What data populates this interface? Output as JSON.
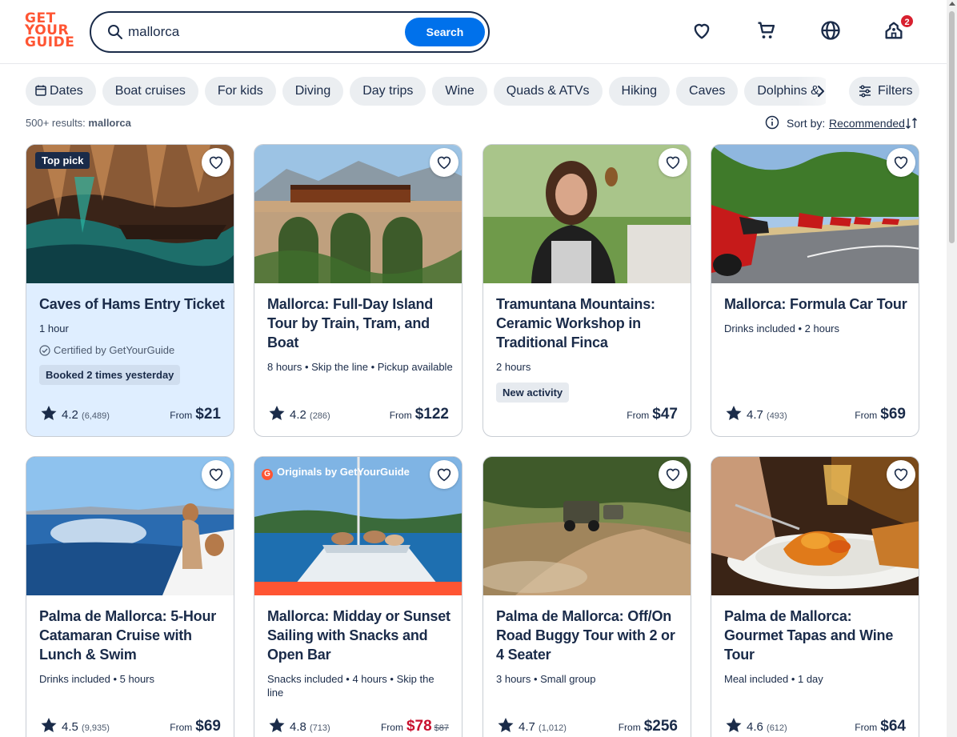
{
  "header": {
    "logo_lines": [
      "GET",
      "YOUR",
      "GUIDE"
    ],
    "search_value": "mallorca",
    "search_button": "Search",
    "cart_badge": "2"
  },
  "chips": [
    "Dates",
    "Boat cruises",
    "For kids",
    "Diving",
    "Day trips",
    "Wine",
    "Quads & ATVs",
    "Hiking",
    "Caves",
    "Dolphins &"
  ],
  "filters_label": "Filters",
  "results": {
    "count": "500+ results:",
    "query": "mallorca"
  },
  "sort": {
    "label": "Sort by:",
    "value": "Recommended"
  },
  "cards": [
    {
      "badge": "Top pick",
      "title": "Caves of Hams Entry Ticket",
      "meta": "1 hour",
      "certified": "Certified by GetYourGuide",
      "pill": "Booked 2 times yesterday",
      "rating": "4.2",
      "reviews": "(6,489)",
      "from": "From",
      "price": "$21"
    },
    {
      "title": "Mallorca: Full-Day Island Tour by Train, Tram, and Boat",
      "meta": "8 hours • Skip the line • Pickup available",
      "rating": "4.2",
      "reviews": "(286)",
      "from": "From",
      "price": "$122"
    },
    {
      "title": "Tramuntana Mountains: Ceramic Workshop in Traditional Finca",
      "meta": "2 hours",
      "pill": "New activity",
      "from": "From",
      "price": "$47"
    },
    {
      "title": "Mallorca: Formula Car Tour",
      "meta": "Drinks included • 2 hours",
      "rating": "4.7",
      "reviews": "(493)",
      "from": "From",
      "price": "$69"
    },
    {
      "title": "Palma de Mallorca: 5-Hour Catamaran Cruise with Lunch & Swim",
      "meta": "Drinks included • 5 hours",
      "rating": "4.5",
      "reviews": "(9,935)",
      "from": "From",
      "price": "$69"
    },
    {
      "badge": "Originals by GetYourGuide",
      "title": "Mallorca: Midday or Sunset Sailing with Snacks and Open Bar",
      "meta": "Snacks included • 4 hours • Skip the line",
      "rating": "4.8",
      "reviews": "(713)",
      "from": "From",
      "price": "$78",
      "old_price": "$87"
    },
    {
      "title": "Palma de Mallorca: Off/On Road Buggy Tour with 2 or 4 Seater",
      "meta": "3 hours • Small group",
      "rating": "4.7",
      "reviews": "(1,012)",
      "from": "From",
      "price": "$256"
    },
    {
      "title": "Palma de Mallorca: Gourmet Tapas and Wine Tour",
      "meta": "Meal included • 1 day",
      "rating": "4.6",
      "reviews": "(612)",
      "from": "From",
      "price": "$64"
    }
  ],
  "colors": {
    "brand": "#ff5533",
    "primary": "#0071eb",
    "text": "#1a2b49",
    "sale": "#c8102e"
  }
}
